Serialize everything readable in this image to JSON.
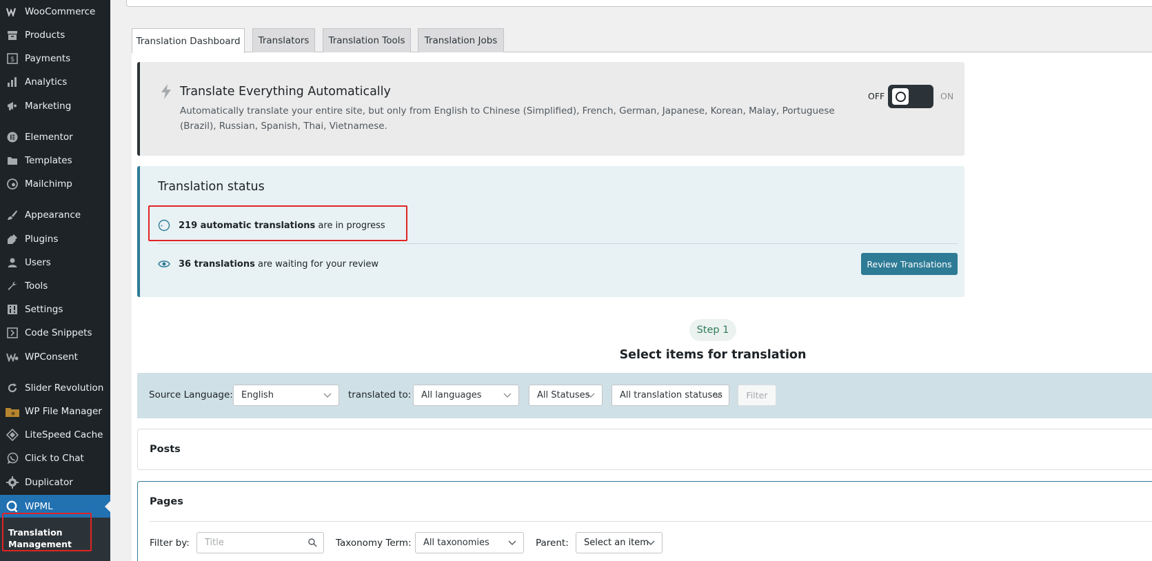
{
  "sidebar": {
    "items": [
      {
        "label": "WooCommerce",
        "icon": "woocommerce-icon"
      },
      {
        "label": "Products",
        "icon": "archive-icon"
      },
      {
        "label": "Payments",
        "icon": "dollar-icon"
      },
      {
        "label": "Analytics",
        "icon": "bar-chart-icon"
      },
      {
        "label": "Marketing",
        "icon": "megaphone-icon"
      },
      {
        "label": "Elementor",
        "icon": "elementor-icon"
      },
      {
        "label": "Templates",
        "icon": "folder-icon"
      },
      {
        "label": "Mailchimp",
        "icon": "mailchimp-icon"
      },
      {
        "label": "Appearance",
        "icon": "paintbrush-icon"
      },
      {
        "label": "Plugins",
        "icon": "plugin-icon"
      },
      {
        "label": "Users",
        "icon": "user-icon"
      },
      {
        "label": "Tools",
        "icon": "wrench-icon"
      },
      {
        "label": "Settings",
        "icon": "settings-icon"
      },
      {
        "label": "Code Snippets",
        "icon": "code-icon"
      },
      {
        "label": "WPConsent",
        "icon": "wpconsent-icon"
      },
      {
        "label": "Slider Revolution",
        "icon": "refresh-icon"
      },
      {
        "label": "WP File Manager",
        "icon": "file-manager-icon"
      },
      {
        "label": "LiteSpeed Cache",
        "icon": "diamond-icon"
      },
      {
        "label": "Click to Chat",
        "icon": "whatsapp-icon"
      },
      {
        "label": "Duplicator",
        "icon": "duplicator-icon"
      },
      {
        "label": "WPML",
        "icon": "wpml-icon"
      }
    ],
    "submenu_item": "Translation Management"
  },
  "tabs": [
    {
      "label": "Translation Dashboard"
    },
    {
      "label": "Translators"
    },
    {
      "label": "Translation Tools"
    },
    {
      "label": "Translation Jobs"
    }
  ],
  "auto_translate": {
    "title": "Translate Everything Automatically",
    "description": "Automatically translate your entire site, but only from English to Chinese (Simplified), French, German, Japanese, Korean, Malay, Portuguese (Brazil), Russian, Spanish, Thai, Vietnamese.",
    "toggle_off": "OFF",
    "toggle_on": "ON"
  },
  "status": {
    "title": "Translation status",
    "in_progress_bold": "219 automatic translations",
    "in_progress_rest": " are in progress",
    "review_bold": "36 translations",
    "review_rest": " are waiting for your review",
    "review_button": "Review Translations"
  },
  "step": {
    "pill": "Step 1",
    "heading": "Select items for translation"
  },
  "filters": {
    "source_label": "Source Language:",
    "source_value": "English",
    "translated_label": "translated to:",
    "translated_value": "All languages",
    "status_value": "All Statuses",
    "translation_status_value": "All translation statuses",
    "filter_button": "Filter"
  },
  "posts": {
    "title": "Posts"
  },
  "pages": {
    "title": "Pages",
    "filter_by_label": "Filter by:",
    "title_placeholder": "Title",
    "taxonomy_label": "Taxonomy Term:",
    "taxonomy_value": "All taxonomies",
    "parent_label": "Parent:",
    "parent_value": "Select an item"
  },
  "colors": {
    "sidebar_bg": "#1d2327",
    "active_menu": "#2271b1",
    "accent_teal": "#2e7b95",
    "highlight_red": "#e02424"
  }
}
